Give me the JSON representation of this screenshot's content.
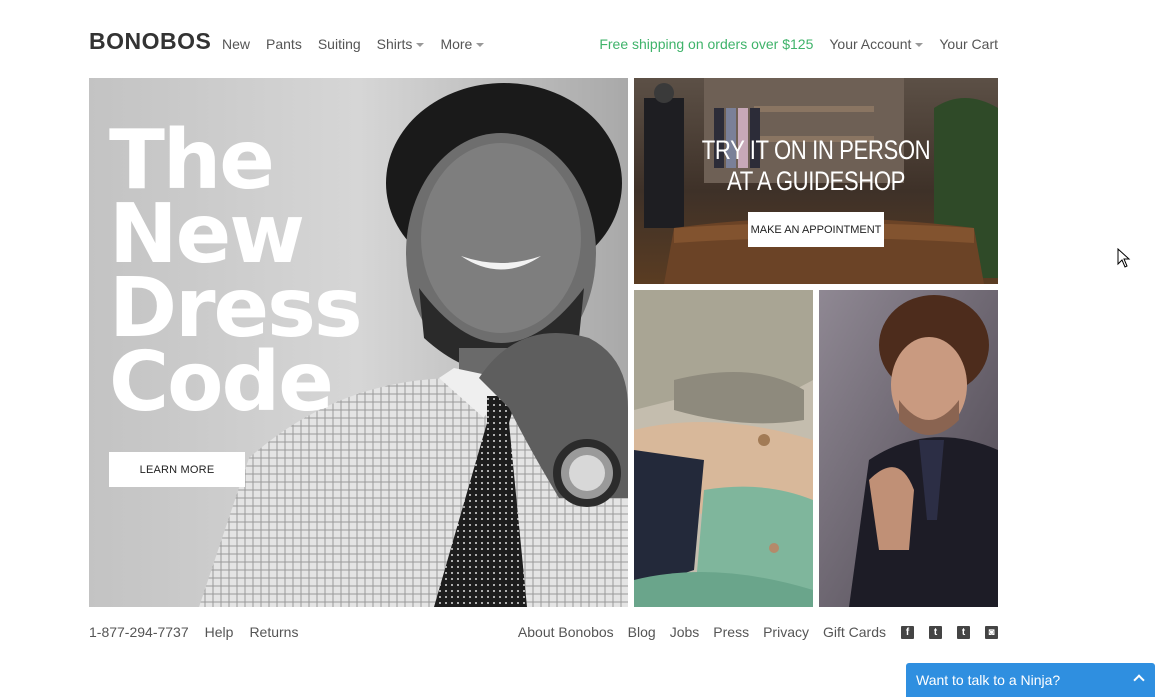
{
  "header": {
    "logo": "BONOBOS",
    "nav": [
      {
        "label": "New",
        "dropdown": false
      },
      {
        "label": "Pants",
        "dropdown": false
      },
      {
        "label": "Suiting",
        "dropdown": false
      },
      {
        "label": "Shirts",
        "dropdown": true
      },
      {
        "label": "More",
        "dropdown": true
      }
    ],
    "promo": "Free shipping on orders over $125",
    "account": "Your Account",
    "cart": "Your Cart"
  },
  "hero": {
    "title_lines": [
      "The",
      "New",
      "Dress",
      "Code"
    ],
    "button": "LEARN MORE"
  },
  "store_tile": {
    "line1": "TRY IT ON IN PERSON",
    "line2": "AT A GUIDESHOP",
    "button": "MAKE AN APPOINTMENT"
  },
  "footer": {
    "phone": "1-877-294-7737",
    "help": "Help",
    "returns": "Returns",
    "links": [
      "About Bonobos",
      "Blog",
      "Jobs",
      "Press",
      "Privacy",
      "Gift Cards"
    ],
    "social": [
      {
        "icon": "facebook-icon",
        "glyph": "f"
      },
      {
        "icon": "twitter-icon",
        "glyph": "t"
      },
      {
        "icon": "tumblr-icon",
        "glyph": "t"
      },
      {
        "icon": "instagram-icon",
        "glyph": "◙"
      }
    ]
  },
  "chat": {
    "label": "Want to talk to a Ninja?"
  },
  "colors": {
    "promo": "#3fb36a",
    "chat": "#2f8fe0",
    "text": "#555555"
  }
}
